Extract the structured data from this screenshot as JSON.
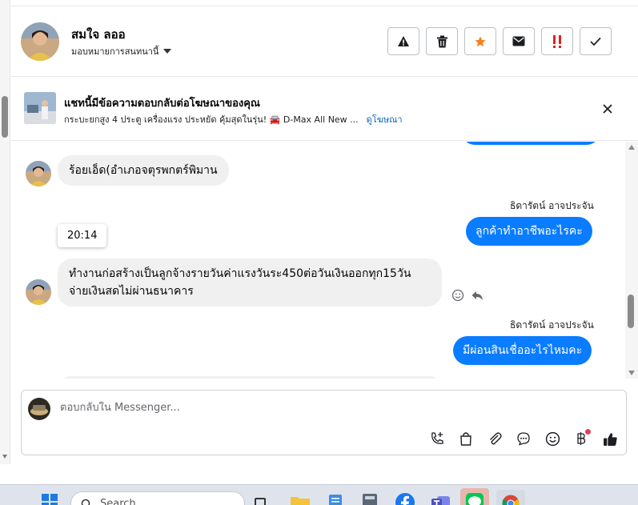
{
  "header": {
    "contact_name": "สมใจ ลออ",
    "assign_label": "มอบหมายการสนทนานี้",
    "actions": [
      {
        "name": "report-button",
        "icon": "warning-icon"
      },
      {
        "name": "delete-button",
        "icon": "trash-icon"
      },
      {
        "name": "star-button",
        "icon": "star-icon"
      },
      {
        "name": "mail-button",
        "icon": "envelope-icon"
      },
      {
        "name": "priority-button",
        "icon": "double-exclamation-icon"
      },
      {
        "name": "done-button",
        "icon": "checkmark-icon"
      }
    ]
  },
  "banner": {
    "title": "แชทนี้มีข้อความตอบกลับต่อโฆษณาของคุณ",
    "subtitle": "กระบะยกสูง 4 ประตู เครื่องแรง ประหยัด คุ้มสุดในรุ่น! 🚘 D-Max All New ...",
    "link": "ดูโฆษณา"
  },
  "messages": {
    "incoming_1": "ร้อยเอ็ด(อำเภอจตุรพกตร์พิมาน",
    "sender_1": "ธิดารัตน์ อาจประจัน",
    "outgoing_1": "ลูกค้าทำอาชีพอะไรคะ",
    "timestamp": "20:14",
    "incoming_2": "ทำงานก่อสร้างเป็นลูกจ้างรายวันค่าแรงวันระ450ต่อวันเงินออกทุก15วัน จ่ายเงินสดไม่ผ่านธนาคาร",
    "sender_2": "ธิดารัตน์ อาจประจัน",
    "outgoing_2": "มีผ่อนสินเชื่ออะไรไหมคะ"
  },
  "composer": {
    "placeholder": "ตอบกลับใน Messenger...",
    "tools": [
      "phone-add-icon",
      "bag-icon",
      "paperclip-icon",
      "chat-bubble-icon",
      "emoji-icon",
      "baht-icon",
      "thumbs-up-icon"
    ]
  },
  "taskbar": {
    "search_label": "Search"
  },
  "colors": {
    "accent": "#0a7cff",
    "incoming_bubble": "#f0f0f0",
    "star": "#f5821f",
    "priority": "#e02020"
  }
}
